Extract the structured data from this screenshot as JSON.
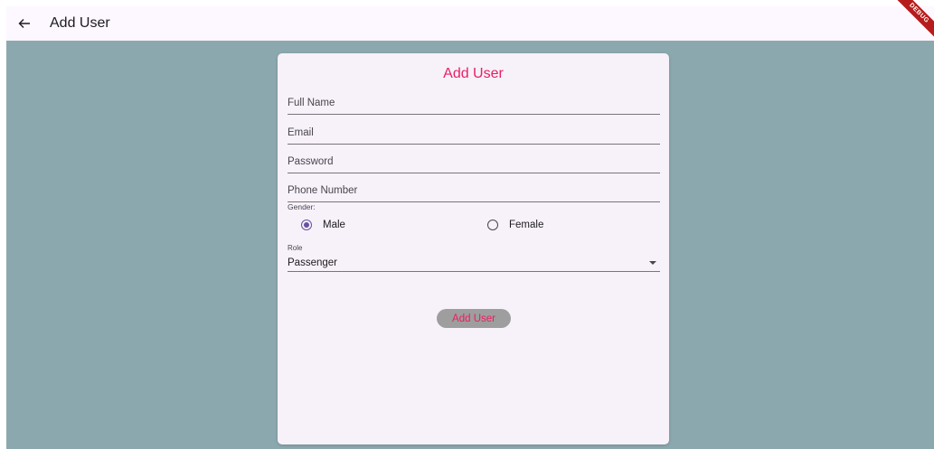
{
  "appbar": {
    "title": "Add User",
    "back_icon": "arrow-left-icon",
    "debug_banner": "DEBUG"
  },
  "form": {
    "title": "Add User",
    "fields": {
      "full_name": {
        "placeholder": "Full Name",
        "value": ""
      },
      "email": {
        "placeholder": "Email",
        "value": ""
      },
      "password": {
        "placeholder": "Password",
        "value": ""
      },
      "phone": {
        "placeholder": "Phone Number",
        "value": ""
      }
    },
    "gender": {
      "label": "Gender:",
      "options": [
        "Male",
        "Female"
      ],
      "selected": "Male"
    },
    "role": {
      "label": "Role",
      "selected": "Passenger"
    },
    "submit_label": "Add User"
  },
  "colors": {
    "accent_pink": "#e91e63",
    "radio_purple": "#6750a4",
    "background": "#8ca8af",
    "card": "#f7f1f9",
    "button": "#9e9e9e"
  }
}
